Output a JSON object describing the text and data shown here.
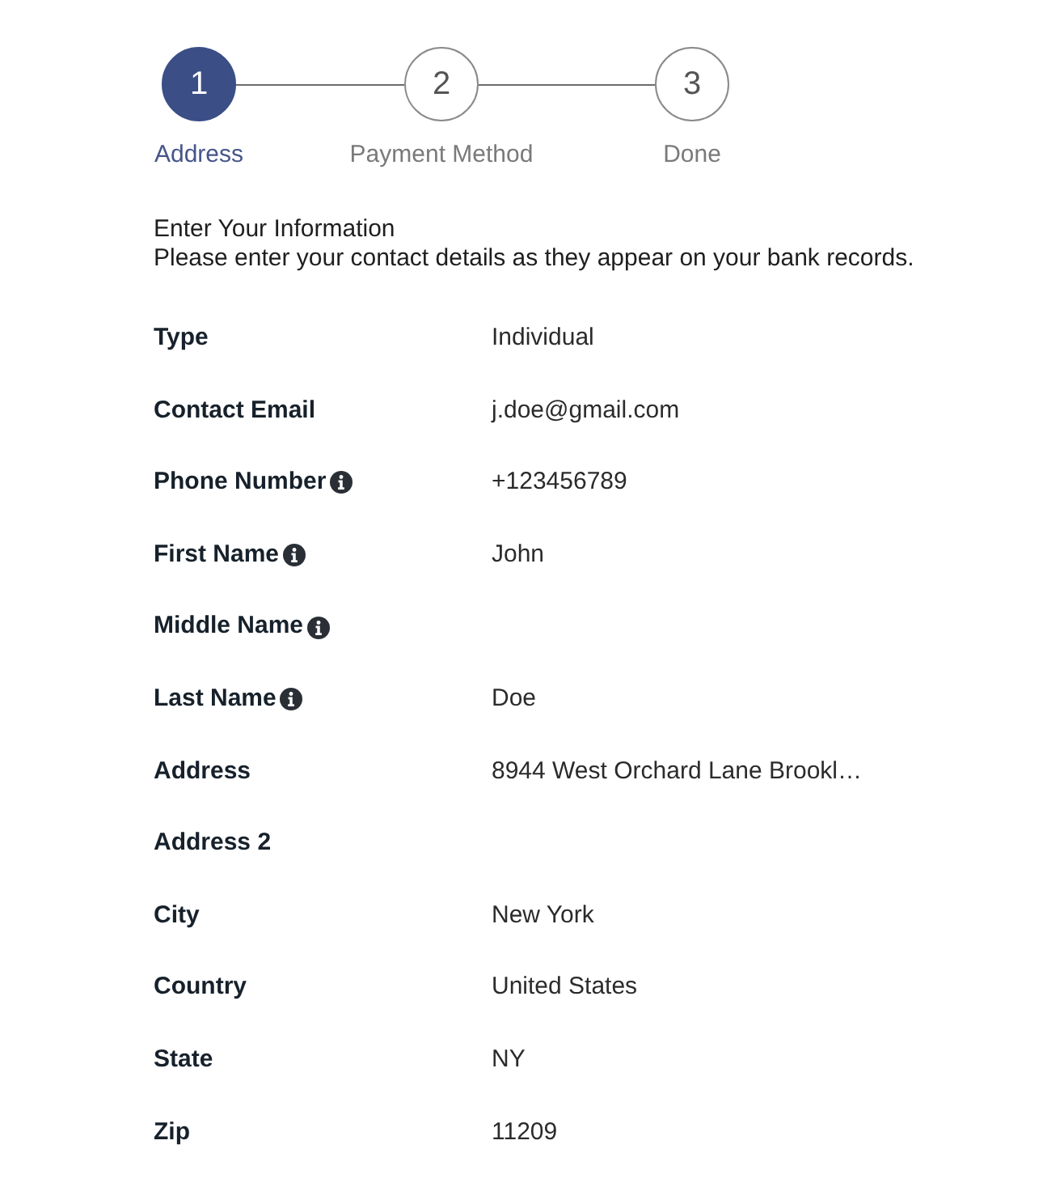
{
  "steps": [
    {
      "number": "1",
      "label": "Address",
      "selected": true
    },
    {
      "number": "2",
      "label": "Payment Method",
      "selected": false
    },
    {
      "number": "3",
      "label": "Done",
      "selected": false
    }
  ],
  "intro": {
    "title": "Enter Your Information",
    "text": "Please enter your contact details as they appear on your bank records."
  },
  "fields": [
    {
      "label": "Type",
      "info": false,
      "value": "Individual"
    },
    {
      "label": "Contact Email",
      "info": false,
      "value": "j.doe@gmail.com"
    },
    {
      "label": "Phone Number",
      "info": true,
      "value": "+123456789"
    },
    {
      "label": "First Name",
      "info": true,
      "value": "John"
    },
    {
      "label": "Middle Name",
      "info": true
    },
    {
      "label": "Last Name",
      "info": true,
      "value": "Doe"
    },
    {
      "label": "Address",
      "info": false,
      "value": "8944 West Orchard Lane Brookl…"
    },
    {
      "label": "Address 2",
      "info": false
    },
    {
      "label": "City",
      "info": false,
      "value": "New York"
    },
    {
      "label": "Country",
      "info": false,
      "value": "United States"
    },
    {
      "label": "State",
      "info": false,
      "value": "NY"
    },
    {
      "label": "Zip",
      "info": false,
      "value": "11209"
    }
  ]
}
